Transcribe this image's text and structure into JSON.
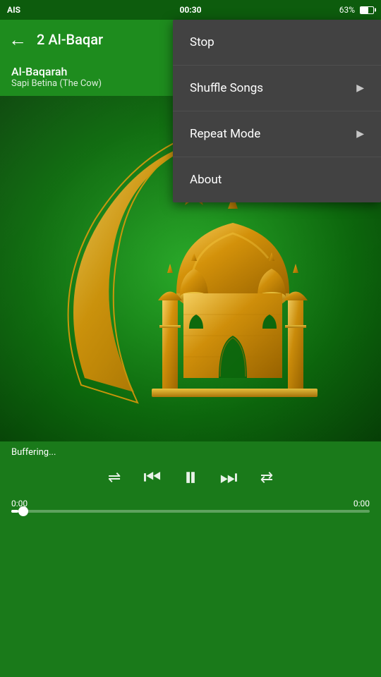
{
  "status": {
    "carrier": "AIS",
    "signal": "|||",
    "time": "00:30",
    "battery": "63%"
  },
  "toolbar": {
    "back_label": "←",
    "title": "2 Al-Baqar"
  },
  "song": {
    "title": "Al-Baqarah",
    "subtitle": "Sapi Betina (The Cow)"
  },
  "player": {
    "buffering": "Buffering...",
    "time_current": "0:00",
    "time_total": "0:00",
    "progress": 2
  },
  "menu": {
    "items": [
      {
        "label": "Stop",
        "has_arrow": false
      },
      {
        "label": "Shuffle Songs",
        "has_arrow": true
      },
      {
        "label": "Repeat Mode",
        "has_arrow": true
      },
      {
        "label": "About",
        "has_arrow": false
      }
    ]
  },
  "controls": {
    "shuffle": "⇌",
    "prev": "⏮",
    "pause": "⏸",
    "next": "⏭",
    "repeat": "⇄"
  }
}
